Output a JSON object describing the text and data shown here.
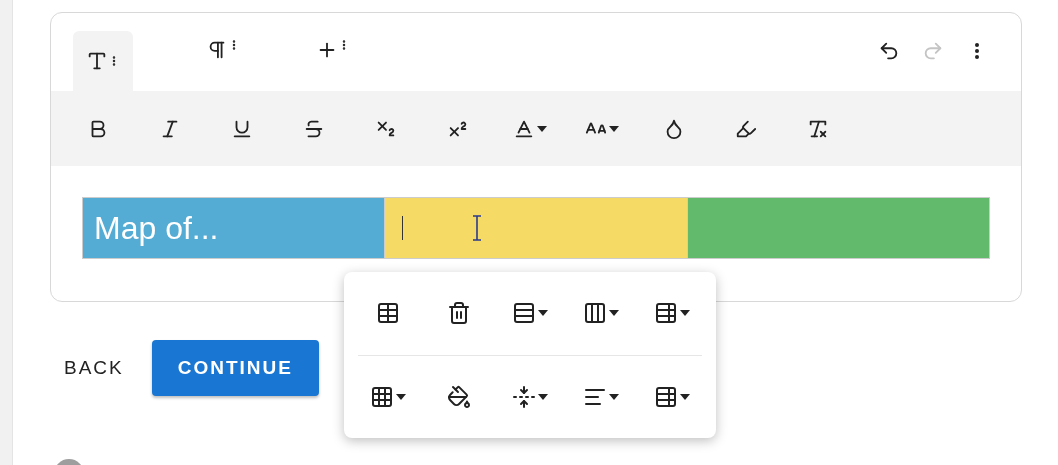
{
  "mode_tabs": [
    {
      "kind": "text",
      "selected": true
    },
    {
      "kind": "paragraph",
      "selected": false
    },
    {
      "kind": "insert",
      "selected": false
    }
  ],
  "history": [
    {
      "kind": "undo",
      "disabled": false
    },
    {
      "kind": "redo",
      "disabled": true
    }
  ],
  "format_tools": [
    {
      "kind": "bold"
    },
    {
      "kind": "italic"
    },
    {
      "kind": "underline"
    },
    {
      "kind": "strikethrough"
    },
    {
      "kind": "subscript"
    },
    {
      "kind": "superscript"
    },
    {
      "kind": "font-color"
    },
    {
      "kind": "font-size"
    },
    {
      "kind": "text-color"
    },
    {
      "kind": "highlight"
    },
    {
      "kind": "clear-format"
    }
  ],
  "table": {
    "cells": [
      {
        "text": "Map of...",
        "color": "#54abd4",
        "cursor": false
      },
      {
        "color": "#f5da66",
        "cursor": true
      },
      {
        "color": "#62bb6d",
        "cursor": false
      }
    ]
  },
  "table_menu": {
    "rows": [
      [
        {
          "kind": "table",
          "dropdown": false
        },
        {
          "kind": "delete",
          "dropdown": false
        },
        {
          "kind": "rows",
          "dropdown": true
        },
        {
          "kind": "columns",
          "dropdown": true
        },
        {
          "kind": "table-style",
          "dropdown": true
        }
      ],
      [
        {
          "kind": "cells",
          "dropdown": true
        },
        {
          "kind": "fill",
          "dropdown": false
        },
        {
          "kind": "height",
          "dropdown": true
        },
        {
          "kind": "align",
          "dropdown": true
        },
        {
          "kind": "table-style",
          "dropdown": true
        }
      ]
    ]
  },
  "buttons": [
    {
      "label": "BACK",
      "kind": "text"
    },
    {
      "label": "CONTINUE",
      "kind": "primary"
    }
  ]
}
